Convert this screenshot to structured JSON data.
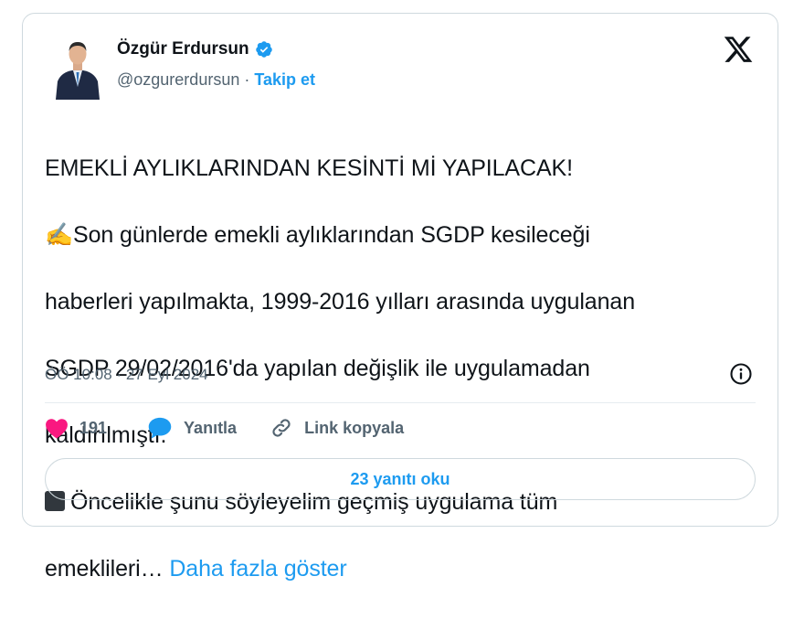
{
  "author": {
    "name": "Özgür Erdursun",
    "handle": "@ozgurerdursun",
    "separator": "·",
    "follow_label": "Takip et"
  },
  "tweet": {
    "line1": "EMEKLİ AYLIKLARINDAN KESİNTİ Mİ YAPILACAK!",
    "line2_emoji": "✍️",
    "line2": "Son günlerde emekli aylıklarından SGDP kesileceği",
    "line3": "haberleri yapılmakta, 1999-2016 yılları arasında uygulanan",
    "line4": "SGDP 29/02/2016'da yapılan değişlik ile uygulamadan",
    "line5": "kaldırılmıştı.",
    "line6": "Öncelikle şunu söyleyelim geçmiş uygulama tüm",
    "line7": "emeklileri…",
    "show_more": "Daha fazla göster"
  },
  "timestamp": "ÖÖ 10:08 · 27 Eyl 2024",
  "actions": {
    "likes": "191",
    "reply_label": "Yanıtla",
    "copy_link_label": "Link kopyala"
  },
  "read_replies_label": "23 yanıtı oku",
  "colors": {
    "accent": "#1d9bf0",
    "like": "#f91880",
    "muted": "#536471",
    "border": "#cfd9de"
  },
  "icons": [
    "verified-badge-icon",
    "x-logo-icon",
    "info-icon",
    "heart-icon",
    "reply-bubble-icon",
    "link-icon"
  ]
}
